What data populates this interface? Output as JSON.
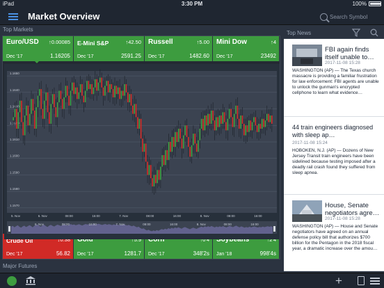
{
  "status_bar": {
    "carrier": "iPad",
    "time": "3:30 PM",
    "battery": "100%"
  },
  "nav": {
    "title": "Market Overview",
    "search_placeholder": "Search Symbol"
  },
  "sections": {
    "top_markets": "Top Markets",
    "major_futures": "Major Futures",
    "top_news": "Top News"
  },
  "top_tiles": [
    {
      "name": "Euro/USD",
      "sub": "Dec '17",
      "change": "↑0.00085",
      "price": "1.16205",
      "color": "green"
    },
    {
      "name": "E-Mini S&P",
      "sub": "Dec '17",
      "change": "↑42.50",
      "price": "2591.25",
      "color": "green"
    },
    {
      "name": "Russell",
      "sub": "Dec '17",
      "change": "↑5.00",
      "price": "1482.60",
      "color": "green"
    },
    {
      "name": "Mini Dow",
      "sub": "Dec '17",
      "change": "↑4",
      "price": "23492",
      "color": "green"
    }
  ],
  "bottom_tiles": [
    {
      "name": "Crude Oil",
      "sub": "Dec '17",
      "change": "↓0.38",
      "price": "56.82",
      "color": "red"
    },
    {
      "name": "Gold",
      "sub": "Dec '17",
      "change": "↑5.9",
      "price": "1281.7",
      "color": "green"
    },
    {
      "name": "Corn",
      "sub": "Dec '17",
      "change": "↑0'4",
      "price": "348'2s",
      "color": "green"
    },
    {
      "name": "Soybeans",
      "sub": "Jan '18",
      "change": "↑2'4",
      "price": "998'4s",
      "color": "green"
    }
  ],
  "chart_data": {
    "type": "candlestick",
    "title": "",
    "y_ticks": [
      "1.1650",
      "1.1640",
      "1.1630",
      "1.1620",
      "1.1610",
      "1.1600",
      "1.1590",
      "1.1580",
      "1.1570"
    ],
    "ylim": [
      1.1567,
      1.1653
    ],
    "x_ticks": [
      "5. Nov",
      "6. Nov",
      "08:00",
      "16:00",
      "7. Nov",
      "08:00",
      "16:00",
      "8. Nov",
      "08:00",
      "16:00"
    ],
    "navigator_ticks": [
      "6. Nov",
      "08:00",
      "16:00",
      "7. Nov",
      "08:00",
      "16:00",
      "8. Nov",
      "08:00",
      "16:00"
    ],
    "closes": [
      1.1625,
      1.163,
      1.1618,
      1.1628,
      1.1635,
      1.1622,
      1.1614,
      1.1626,
      1.1632,
      1.162,
      1.1627,
      1.1636,
      1.1629,
      1.1618,
      1.1631,
      1.1638,
      1.1642,
      1.163,
      1.1624,
      1.1635,
      1.164,
      1.1628,
      1.1621,
      1.1633,
      1.1639,
      1.1631,
      1.1625,
      1.1634,
      1.1641,
      1.1636,
      1.163,
      1.1637,
      1.1644,
      1.1638,
      1.1632,
      1.1641,
      1.1646,
      1.1639,
      1.1643,
      1.1636,
      1.164,
      1.1645,
      1.1638,
      1.1634,
      1.1641,
      1.1647,
      1.1642,
      1.1645,
      1.1639,
      1.1643,
      1.1648,
      1.1641,
      1.1646,
      1.1649,
      1.1643,
      1.1638,
      1.1644,
      1.1647,
      1.164,
      1.1645,
      1.1642,
      1.1637,
      1.1644,
      1.1639,
      1.1643,
      1.1636,
      1.1641,
      1.1638,
      1.1645,
      1.164,
      1.1634,
      1.1639,
      1.1632,
      1.1627,
      1.1633,
      1.1625,
      1.1618,
      1.1624,
      1.1612,
      1.1604,
      1.1609,
      1.1598,
      1.159,
      1.1596,
      1.1588,
      1.1583,
      1.159,
      1.1585,
      1.1593,
      1.1587,
      1.1595,
      1.1602,
      1.1596,
      1.1605,
      1.1599,
      1.161,
      1.1604,
      1.1613,
      1.1607,
      1.1616,
      1.161,
      1.1618,
      1.1612,
      1.1606,
      1.1614,
      1.162,
      1.1613,
      1.1607,
      1.1601,
      1.1608,
      1.1615,
      1.1609,
      1.1604,
      1.1611,
      1.1618,
      1.1624,
      1.1617,
      1.1626,
      1.162,
      1.1627,
      1.1621,
      1.1629,
      1.1623,
      1.1617,
      1.1625,
      1.1619,
      1.1626,
      1.1621,
      1.1628,
      1.1622,
      1.1617,
      1.1624,
      1.163,
      1.1625,
      1.1619,
      1.1627,
      1.1632,
      1.1624,
      1.1618,
      1.1626,
      1.1621,
      1.1614,
      1.162,
      1.1616,
      1.1623,
      1.1617,
      1.1622,
      1.1625,
      1.162,
      1.1616,
      1.1621,
      1.1618,
      1.1624,
      1.1619,
      1.1623,
      1.1627,
      1.1622,
      1.1626,
      1.1621
    ]
  },
  "news": [
    {
      "title": "FBI again finds itself unable to…",
      "date": "2017-11-08 15:28",
      "body": "WASHINGTON (AP) — The Texas church massacre is providing a familiar frustration for law enforcement: FBI agents are unable to unlock the gunman's encrypted cellphone to learn what evidence…",
      "has_thumb": true
    },
    {
      "title": "44 train engineers diagnosed with sleep ap…",
      "date": "2017-11-08 15:24",
      "body": "HOBOKEN, N.J. (AP) — Dozens of New Jersey Transit train engineers have been sidelined because testing imposed after a deadly rail crash found they suffered from sleep apnea.",
      "has_thumb": false
    },
    {
      "title": "House, Senate negotiators agre…",
      "date": "2017-11-08 15:28",
      "body": "WASHINGTON (AP) — House and Senate negotiators have agreed on an annual defense policy bill that authorizes $700 billion for the Pentagon in the 2018 fiscal year, a dramatic increase over the amou…",
      "has_thumb": true
    }
  ],
  "colors": {
    "up": "#3d9c3f",
    "down": "#d12a26",
    "accent": "#4a90e2"
  }
}
